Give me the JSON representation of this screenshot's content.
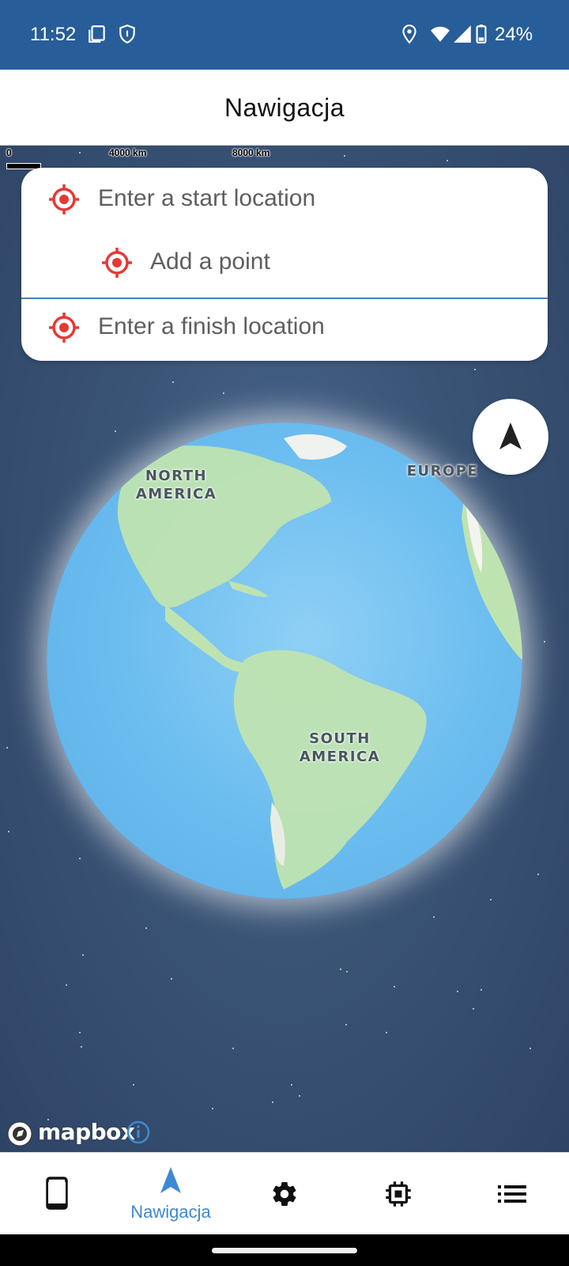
{
  "status_bar": {
    "time": "11:52",
    "battery": "24%",
    "icons": [
      "copy-icon",
      "shield-icon",
      "location-icon",
      "wifi-icon",
      "signal-icon",
      "battery-icon"
    ]
  },
  "header": {
    "title": "Nawigacja"
  },
  "map": {
    "scale": {
      "zero": "0",
      "mid": "4000 km",
      "max": "8000 km"
    },
    "labels": {
      "north_america": [
        "NORTH",
        "AMERICA"
      ],
      "south_america": [
        "SOUTH",
        "AMERICA"
      ],
      "europe": "EUROPE"
    },
    "attribution": "mapbox"
  },
  "route": {
    "start_placeholder": "Enter a start location",
    "point_placeholder": "Add a point",
    "finish_placeholder": "Enter a finish location"
  },
  "bottom_nav": {
    "items": [
      {
        "icon": "phone-icon",
        "label": ""
      },
      {
        "icon": "navigation-arrow-icon",
        "label": "Nawigacja",
        "active": true
      },
      {
        "icon": "gear-icon",
        "label": ""
      },
      {
        "icon": "chip-icon",
        "label": ""
      },
      {
        "icon": "list-icon",
        "label": ""
      }
    ]
  },
  "colors": {
    "status_bar": "#275d99",
    "accent": "#3f88d3",
    "target_red": "#e53935",
    "space": "#3a5476"
  }
}
